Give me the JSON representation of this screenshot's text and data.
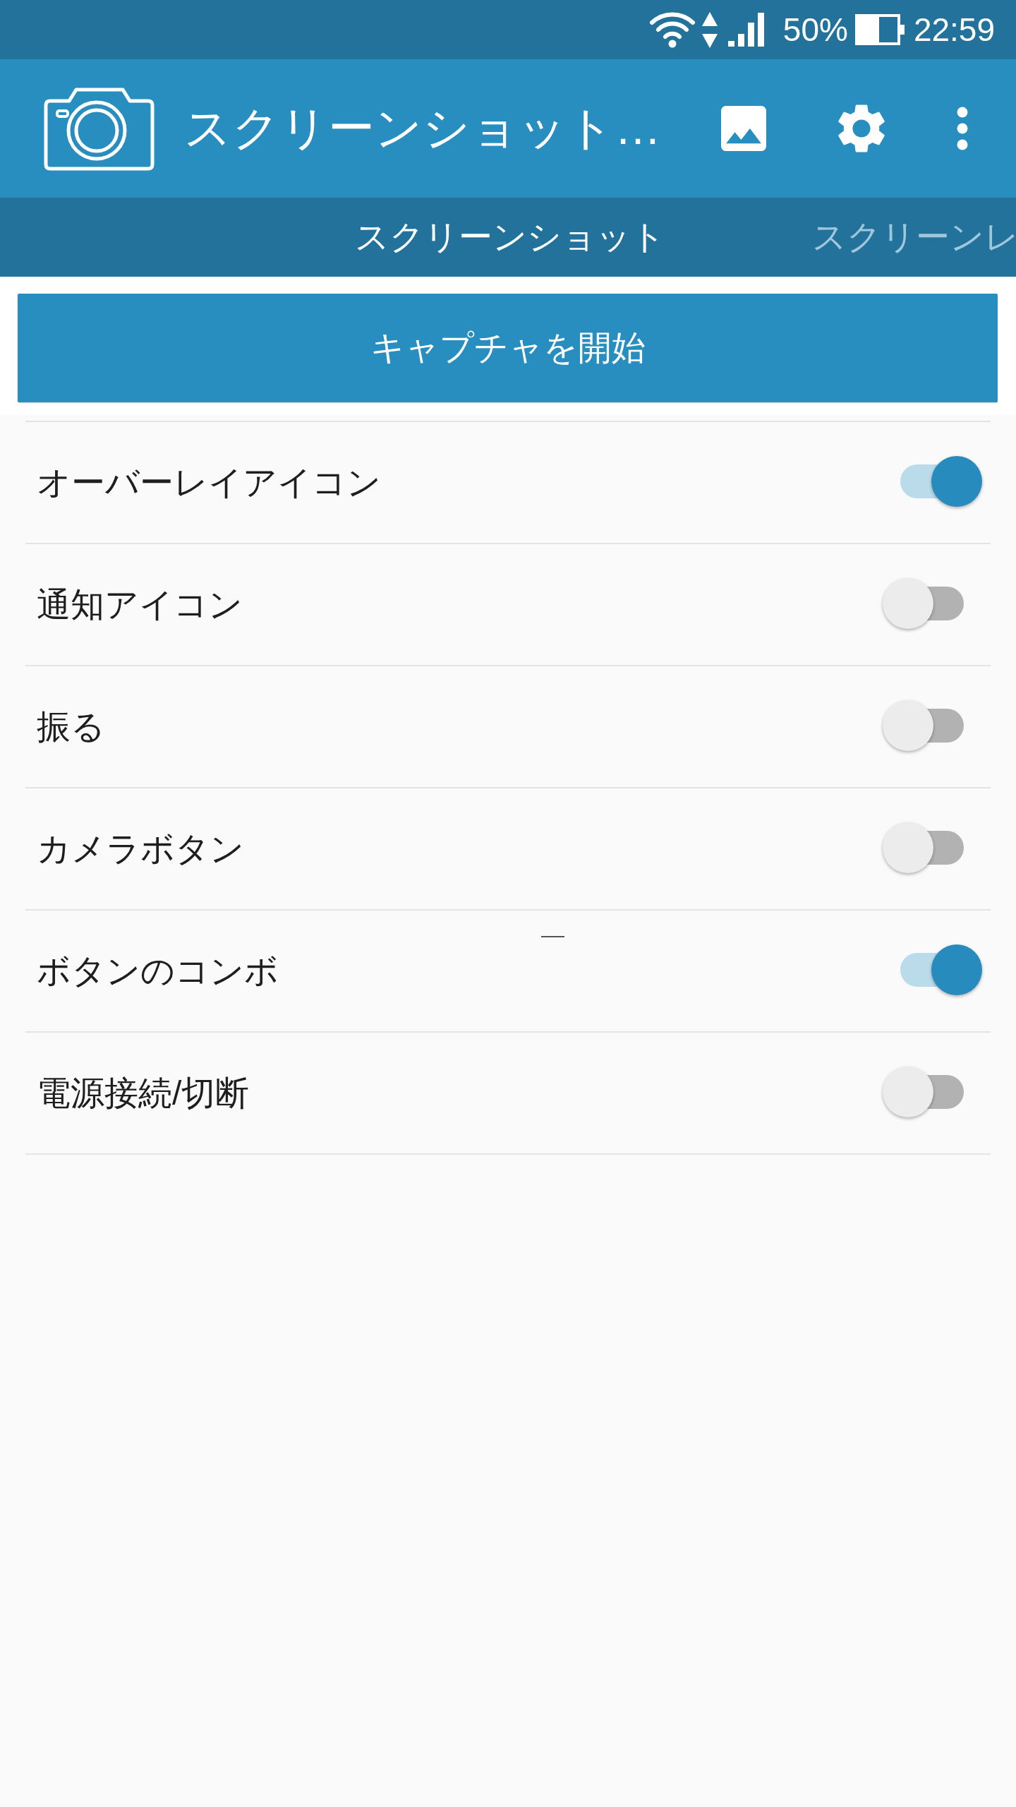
{
  "status_bar": {
    "battery": "50%",
    "time": "22:59"
  },
  "app_bar": {
    "title": "スクリーンショット…"
  },
  "tabs": [
    {
      "label": "スクリーンショット",
      "selected": true
    },
    {
      "label": "スクリーンレ",
      "selected": false
    }
  ],
  "capture_button": {
    "label": "キャプチャを開始"
  },
  "settings": [
    {
      "label": "オーバーレイアイコン",
      "on": true
    },
    {
      "label": "通知アイコン",
      "on": false
    },
    {
      "label": "振る",
      "on": false
    },
    {
      "label": "カメラボタン",
      "on": false
    },
    {
      "label": "ボタンのコンボ",
      "on": true
    },
    {
      "label": "電源接続/切断",
      "on": false
    }
  ]
}
